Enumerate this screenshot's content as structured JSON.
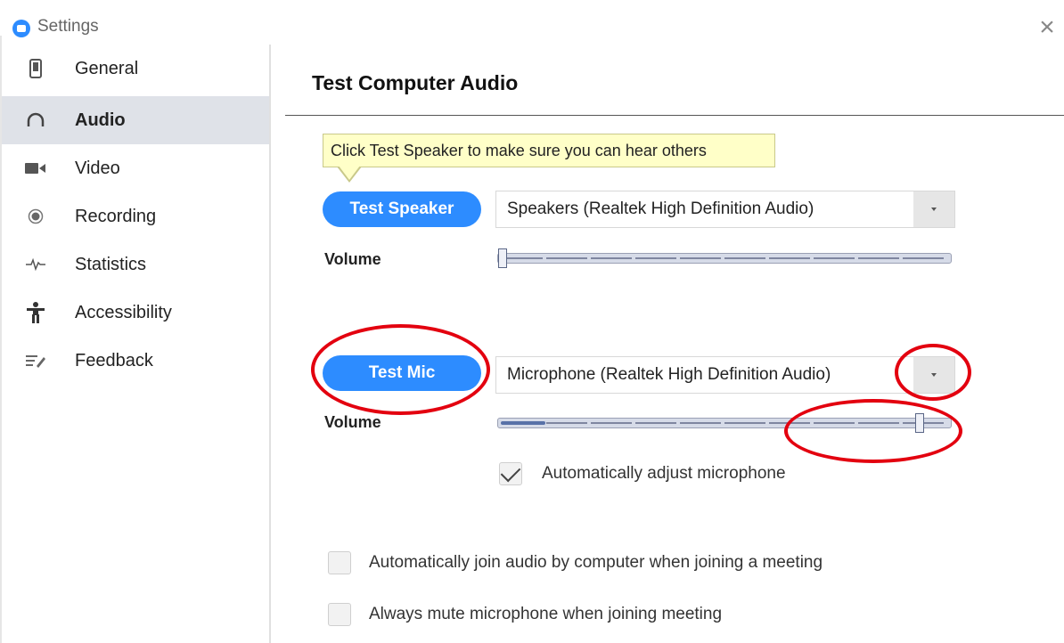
{
  "window": {
    "title": "Settings",
    "close_glyph": "×"
  },
  "sidebar": {
    "items": [
      {
        "label": "General",
        "icon": "phone-icon",
        "active": false
      },
      {
        "label": "Audio",
        "icon": "headphones-icon",
        "active": true
      },
      {
        "label": "Video",
        "icon": "video-camera-icon",
        "active": false
      },
      {
        "label": "Recording",
        "icon": "record-icon",
        "active": false
      },
      {
        "label": "Statistics",
        "icon": "pulse-icon",
        "active": false
      },
      {
        "label": "Accessibility",
        "icon": "accessibility-icon",
        "active": false
      },
      {
        "label": "Feedback",
        "icon": "feedback-icon",
        "active": false
      }
    ]
  },
  "main": {
    "title": "Test Computer Audio",
    "tooltip": "Click Test Speaker to make sure you can hear others",
    "speaker": {
      "button_label": "Test Speaker",
      "device": "Speakers (Realtek High Definition Audio)",
      "volume_label": "Volume",
      "volume_level": 0.0
    },
    "mic": {
      "button_label": "Test Mic",
      "device": "Microphone (Realtek High Definition Audio)",
      "volume_label": "Volume",
      "volume_level": 0.94,
      "input_level": 0.1
    },
    "auto_adjust": {
      "label": "Automatically adjust microphone",
      "checked": true
    },
    "options": [
      {
        "label": "Automatically join audio by computer when joining a meeting",
        "checked": false
      },
      {
        "label": "Always mute microphone when joining meeting",
        "checked": false
      }
    ]
  },
  "colors": {
    "accent": "#2D8CFF",
    "annotation": "#E3000F",
    "tooltip_bg": "#FFFFC8",
    "sidebar_active": "#DFE2E8"
  }
}
